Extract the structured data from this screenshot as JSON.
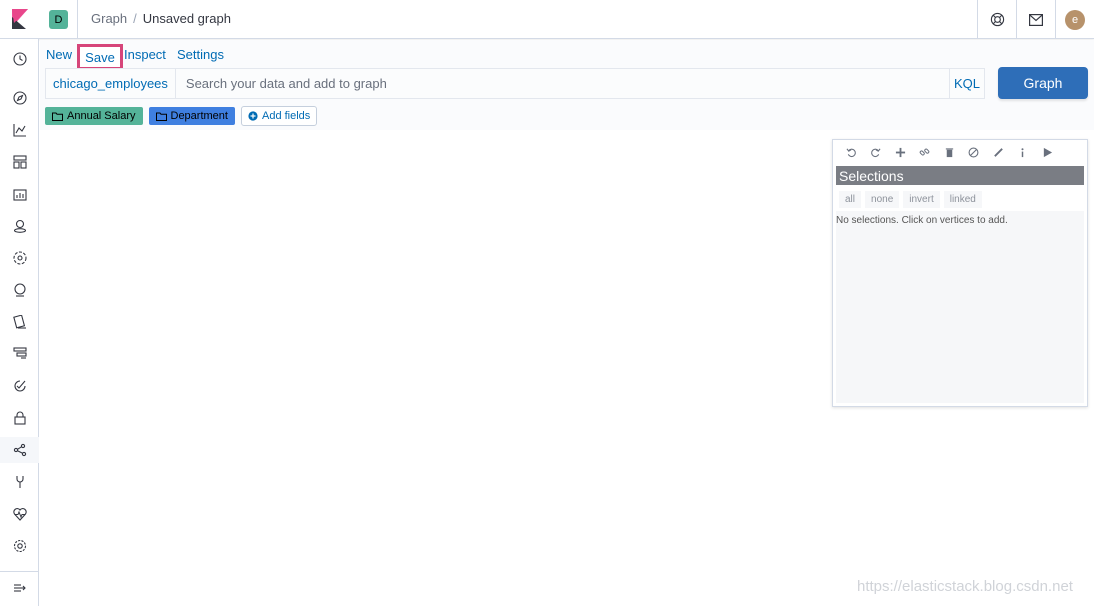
{
  "header": {
    "space_initial": "D",
    "breadcrumb_app": "Graph",
    "breadcrumb_separator": "/",
    "breadcrumb_current": "Unsaved graph",
    "avatar_initial": "e",
    "icons": [
      "help-icon",
      "newsfeed-icon"
    ]
  },
  "sidenav": {
    "items": [
      "recently-viewed-icon",
      "discover-icon",
      "visualize-icon",
      "dashboard-icon",
      "canvas-icon",
      "maps-icon",
      "machine-learning-icon",
      "infrastructure-icon",
      "logs-icon",
      "apm-icon",
      "uptime-icon",
      "siem-icon",
      "graph-icon",
      "dev-tools-icon",
      "monitoring-icon",
      "management-icon"
    ],
    "active": "graph-icon",
    "collapse_icon": "menu-collapse-icon"
  },
  "menu": {
    "new": "New",
    "save": "Save",
    "inspect": "Inspect",
    "settings": "Settings"
  },
  "search": {
    "index_pattern": "chicago_employees",
    "placeholder": "Search your data and add to graph",
    "language": "KQL",
    "submit": "Graph"
  },
  "fields": {
    "items": [
      {
        "label": "Annual Salary",
        "color": "#54b399"
      },
      {
        "label": "Department",
        "color": "#3f7fe0"
      }
    ],
    "add_label": "Add fields"
  },
  "selections": {
    "toolbar_icons": [
      "undo-icon",
      "redo-icon",
      "expand-icon",
      "link-icon",
      "delete-icon",
      "block-icon",
      "style-icon",
      "info-icon",
      "play-icon"
    ],
    "title": "Selections",
    "links": [
      "all",
      "none",
      "invert",
      "linked"
    ],
    "empty_message": "No selections. Click on vertices to add."
  },
  "watermark": "https://elasticstack.blog.csdn.net"
}
